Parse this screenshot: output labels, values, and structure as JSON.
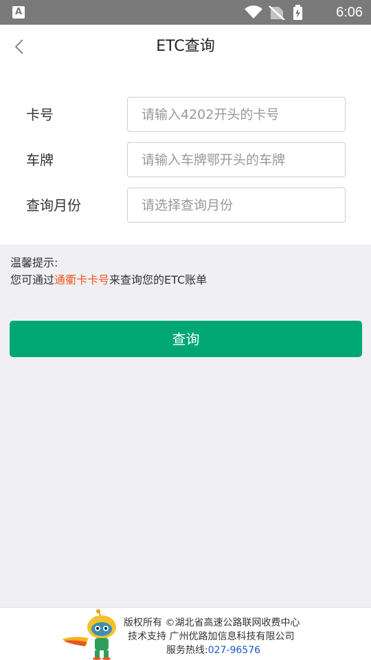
{
  "status_bar": {
    "left_icon_letter": "A",
    "time": "6:06",
    "icons": [
      "wifi-icon",
      "no-sim-icon",
      "battery-charging-icon"
    ]
  },
  "header": {
    "title": "ETC查询",
    "back_icon": "chevron-left-icon"
  },
  "form": {
    "fields": [
      {
        "label": "卡号",
        "placeholder": "请输入4202开头的卡号",
        "value": ""
      },
      {
        "label": "车牌",
        "placeholder": "请输入车牌鄂开头的车牌",
        "value": ""
      },
      {
        "label": "查询月份",
        "placeholder": "请选择查询月份",
        "value": ""
      }
    ]
  },
  "tips": {
    "heading": "温馨提示:",
    "prefix": "您可通过",
    "link": "通衢卡卡号",
    "suffix": "来查询您的ETC账单"
  },
  "query_button": "查询",
  "footer": {
    "copyright": "版权所有 ©湖北省高速公路联网收费中心",
    "support": "技术支持 广州优路加信息科技有限公司",
    "hotline_label": "服务热线:",
    "hotline_number": "027-96576"
  },
  "colors": {
    "accent": "#00a772",
    "link": "#f05a22",
    "hotline": "#1a55c9",
    "page_bg": "#efeff4",
    "status_bar": "#7a7a7a"
  }
}
